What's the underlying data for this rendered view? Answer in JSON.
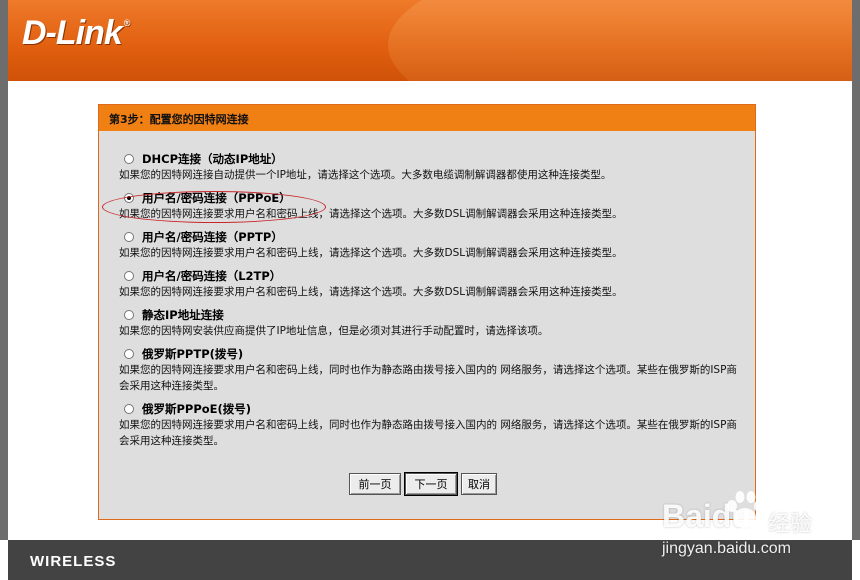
{
  "header": {
    "logo": "D-Link",
    "logo_mark": "®"
  },
  "panel": {
    "title": "第3步：配置您的因特网连接"
  },
  "options": [
    {
      "label": "DHCP连接（动态IP地址）",
      "desc": "如果您的因特网连接自动提供一个IP地址，请选择这个选项。大多数电缆调制解调器都使用这种连接类型。",
      "checked": false
    },
    {
      "label": "用户名/密码连接（PPPoE）",
      "desc": "如果您的因特网连接要求用户名和密码上线，请选择这个选项。大多数DSL调制解调器会采用这种连接类型。",
      "checked": true
    },
    {
      "label": "用户名/密码连接（PPTP）",
      "desc": "如果您的因特网连接要求用户名和密码上线，请选择这个选项。大多数DSL调制解调器会采用这种连接类型。",
      "checked": false
    },
    {
      "label": "用户名/密码连接（L2TP）",
      "desc": "如果您的因特网连接要求用户名和密码上线，请选择这个选项。大多数DSL调制解调器会采用这种连接类型。",
      "checked": false
    },
    {
      "label": "静态IP地址连接",
      "desc": "如果您的因特网安装供应商提供了IP地址信息，但是必须对其进行手动配置时，请选择该项。",
      "checked": false
    },
    {
      "label": "俄罗斯PPTP(拨号)",
      "desc": "如果您的因特网连接要求用户名和密码上线，同时也作为静态路由拨号接入国内的 网络服务，请选择这个选项。某些在俄罗斯的ISP商会采用这种连接类型。",
      "checked": false
    },
    {
      "label": "俄罗斯PPPoE(拨号)",
      "desc": "如果您的因特网连接要求用户名和密码上线，同时也作为静态路由拨号接入国内的 网络服务，请选择这个选项。某些在俄罗斯的ISP商会采用这种连接类型。",
      "checked": false
    }
  ],
  "buttons": {
    "prev": "前一页",
    "next": "下一页",
    "cancel": "取消"
  },
  "footer": {
    "text": "WIRELESS"
  },
  "watermark": {
    "logo": "Bai",
    "logo_suffix": "du",
    "cn": "经验",
    "url": "jingyan.baidu.com"
  },
  "colors": {
    "accent": "#f07f14",
    "header": "#e05f0f",
    "highlight": "#c8262a",
    "footer": "#434343"
  }
}
